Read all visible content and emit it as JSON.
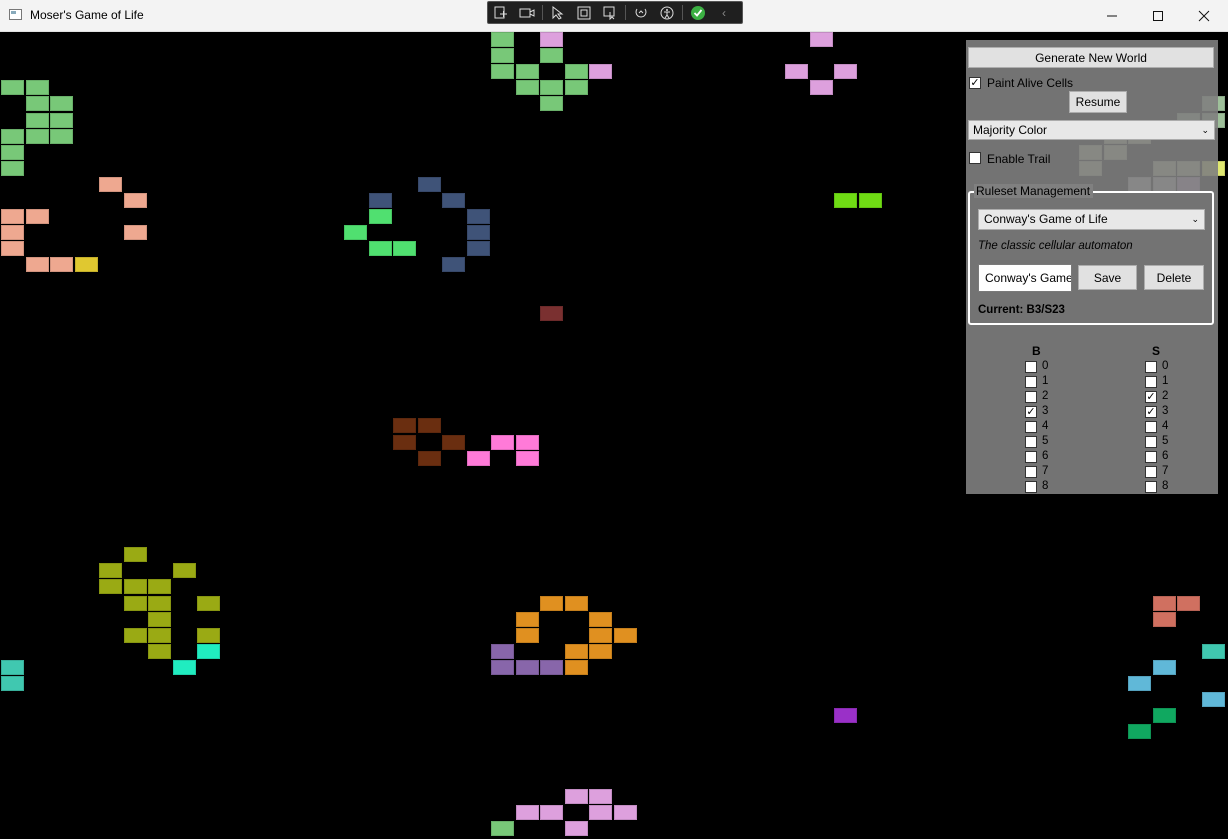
{
  "window": {
    "title": "Moser's Game of Life",
    "controls": [
      "minimize",
      "maximize",
      "close"
    ]
  },
  "debug_toolbar": {
    "icons": [
      "live-visual-tree-icon",
      "record-icon",
      "select-element-icon",
      "display-layout-adorners-icon",
      "track-focus-icon",
      "hot-reload-icon",
      "accessibility-icon",
      "check-icon",
      "collapse-icon"
    ]
  },
  "controls": {
    "generate_label": "Generate New World",
    "paint_alive_label": "Paint Alive Cells",
    "paint_alive_checked": true,
    "resume_label": "Resume",
    "color_mode_selected": "Majority Color",
    "enable_trail_label": "Enable Trail",
    "enable_trail_checked": false
  },
  "ruleset": {
    "legend": "Ruleset Management",
    "selected": "Conway's Game of Life",
    "description": "The classic cellular automaton",
    "name_value": "Conway's Game",
    "save_label": "Save",
    "delete_label": "Delete",
    "current_label": "Current: B3/S23"
  },
  "rules": {
    "birth_header": "B",
    "survival_header": "S",
    "birth": [
      {
        "n": "0",
        "checked": false
      },
      {
        "n": "1",
        "checked": false
      },
      {
        "n": "2",
        "checked": false
      },
      {
        "n": "3",
        "checked": true
      },
      {
        "n": "4",
        "checked": false
      },
      {
        "n": "5",
        "checked": false
      },
      {
        "n": "6",
        "checked": false
      },
      {
        "n": "7",
        "checked": false
      },
      {
        "n": "8",
        "checked": false
      }
    ],
    "survival": [
      {
        "n": "0",
        "checked": false
      },
      {
        "n": "1",
        "checked": false
      },
      {
        "n": "2",
        "checked": true
      },
      {
        "n": "3",
        "checked": true
      },
      {
        "n": "4",
        "checked": false
      },
      {
        "n": "5",
        "checked": false
      },
      {
        "n": "6",
        "checked": false
      },
      {
        "n": "7",
        "checked": false
      },
      {
        "n": "8",
        "checked": false
      }
    ]
  },
  "grid": {
    "background": "#000000",
    "cells": [
      [
        20,
        0,
        "#78c878"
      ],
      [
        22,
        0,
        "#dda0dd"
      ],
      [
        33,
        0,
        "#dda0dd"
      ],
      [
        20,
        1,
        "#78c878"
      ],
      [
        22,
        1,
        "#78c878"
      ],
      [
        20,
        2,
        "#78c878"
      ],
      [
        21,
        2,
        "#78c878"
      ],
      [
        23,
        2,
        "#78c878"
      ],
      [
        24,
        2,
        "#dda0dd"
      ],
      [
        32,
        2,
        "#dda0dd"
      ],
      [
        34,
        2,
        "#dda0dd"
      ],
      [
        0,
        3,
        "#78c878"
      ],
      [
        1,
        3,
        "#78c878"
      ],
      [
        21,
        3,
        "#78c878"
      ],
      [
        22,
        3,
        "#78c878"
      ],
      [
        23,
        3,
        "#78c878"
      ],
      [
        33,
        3,
        "#dda0dd"
      ],
      [
        1,
        4,
        "#78c878"
      ],
      [
        2,
        4,
        "#78c878"
      ],
      [
        22,
        4,
        "#78c878"
      ],
      [
        1,
        5,
        "#78c878"
      ],
      [
        2,
        5,
        "#78c878"
      ],
      [
        0,
        6,
        "#78c878"
      ],
      [
        1,
        6,
        "#78c878"
      ],
      [
        2,
        6,
        "#78c878"
      ],
      [
        0,
        7,
        "#78c878"
      ],
      [
        0,
        8,
        "#78c878"
      ],
      [
        4,
        9,
        "#eea890"
      ],
      [
        17,
        9,
        "#3f5378"
      ],
      [
        5,
        10,
        "#eea890"
      ],
      [
        15,
        10,
        "#3f5378"
      ],
      [
        18,
        10,
        "#3f5378"
      ],
      [
        34,
        10,
        "#6fdc14"
      ],
      [
        35,
        10,
        "#6fdc14"
      ],
      [
        0,
        11,
        "#eea890"
      ],
      [
        1,
        11,
        "#eea890"
      ],
      [
        15,
        11,
        "#50e070"
      ],
      [
        19,
        11,
        "#3f5378"
      ],
      [
        0,
        12,
        "#eea890"
      ],
      [
        5,
        12,
        "#eea890"
      ],
      [
        14,
        12,
        "#50e070"
      ],
      [
        19,
        12,
        "#3f5378"
      ],
      [
        0,
        13,
        "#eea890"
      ],
      [
        15,
        13,
        "#50e070"
      ],
      [
        16,
        13,
        "#50e070"
      ],
      [
        19,
        13,
        "#3f5378"
      ],
      [
        1,
        14,
        "#eea890"
      ],
      [
        2,
        14,
        "#eea890"
      ],
      [
        3,
        14,
        "#e0c830"
      ],
      [
        18,
        14,
        "#3f5378"
      ],
      [
        22,
        17,
        "#7a3030"
      ],
      [
        16,
        24,
        "#6a2e10"
      ],
      [
        17,
        24,
        "#6a2e10"
      ],
      [
        16,
        25,
        "#6a2e10"
      ],
      [
        18,
        25,
        "#6a2e10"
      ],
      [
        20,
        25,
        "#ff7ad8"
      ],
      [
        21,
        25,
        "#ff7ad8"
      ],
      [
        17,
        26,
        "#6a2e10"
      ],
      [
        19,
        26,
        "#ff7ad8"
      ],
      [
        21,
        26,
        "#ff7ad8"
      ],
      [
        5,
        32,
        "#9aaa14"
      ],
      [
        4,
        33,
        "#9aaa14"
      ],
      [
        7,
        33,
        "#9aaa14"
      ],
      [
        4,
        34,
        "#9aaa14"
      ],
      [
        5,
        34,
        "#9aaa14"
      ],
      [
        6,
        34,
        "#9aaa14"
      ],
      [
        5,
        35,
        "#9aaa14"
      ],
      [
        6,
        35,
        "#9aaa14"
      ],
      [
        8,
        35,
        "#9aaa14"
      ],
      [
        22,
        35,
        "#e09020"
      ],
      [
        23,
        35,
        "#e09020"
      ],
      [
        47,
        35,
        "#d07060"
      ],
      [
        48,
        35,
        "#d07060"
      ],
      [
        6,
        36,
        "#9aaa14"
      ],
      [
        21,
        36,
        "#e09020"
      ],
      [
        24,
        36,
        "#e09020"
      ],
      [
        47,
        36,
        "#d07060"
      ],
      [
        5,
        37,
        "#9aaa14"
      ],
      [
        6,
        37,
        "#9aaa14"
      ],
      [
        8,
        37,
        "#9aaa14"
      ],
      [
        21,
        37,
        "#e09020"
      ],
      [
        24,
        37,
        "#e09020"
      ],
      [
        25,
        37,
        "#e09020"
      ],
      [
        6,
        38,
        "#9aaa14"
      ],
      [
        8,
        38,
        "#20ecc0"
      ],
      [
        20,
        38,
        "#8866aa"
      ],
      [
        23,
        38,
        "#e09020"
      ],
      [
        24,
        38,
        "#e09020"
      ],
      [
        49,
        38,
        "#40c8b0"
      ],
      [
        0,
        39,
        "#40c8b0"
      ],
      [
        7,
        39,
        "#20ecc0"
      ],
      [
        20,
        39,
        "#8866aa"
      ],
      [
        21,
        39,
        "#8866aa"
      ],
      [
        22,
        39,
        "#8866aa"
      ],
      [
        23,
        39,
        "#e09020"
      ],
      [
        47,
        39,
        "#60b8d8"
      ],
      [
        0,
        40,
        "#40c8b0"
      ],
      [
        46,
        40,
        "#60b8d8"
      ],
      [
        49,
        41,
        "#60b8d8"
      ],
      [
        34,
        42,
        "#9a30c8"
      ],
      [
        47,
        42,
        "#10a860"
      ],
      [
        46,
        43,
        "#10a860"
      ],
      [
        23,
        47,
        "#dda0dd"
      ],
      [
        24,
        47,
        "#dda0dd"
      ],
      [
        21,
        48,
        "#dda0dd"
      ],
      [
        22,
        48,
        "#dda0dd"
      ],
      [
        24,
        48,
        "#dda0dd"
      ],
      [
        25,
        48,
        "#dda0dd"
      ],
      [
        20,
        49,
        "#78c878"
      ],
      [
        23,
        49,
        "#dda0dd"
      ],
      [
        49,
        4,
        "#9ec09a"
      ],
      [
        48,
        5,
        "#9ec09a"
      ],
      [
        49,
        5,
        "#9ec09a"
      ],
      [
        45,
        6,
        "#c8d4a0"
      ],
      [
        46,
        6,
        "#c8d4a0"
      ],
      [
        44,
        7,
        "#c8d4a0"
      ],
      [
        45,
        7,
        "#c8d4a0"
      ],
      [
        44,
        8,
        "#c8d4a0"
      ],
      [
        47,
        8,
        "#c8d4a0"
      ],
      [
        48,
        8,
        "#c8d4a0"
      ],
      [
        49,
        8,
        "#e0e870"
      ],
      [
        46,
        9,
        "#c8c8c8"
      ],
      [
        47,
        9,
        "#c8c8c8"
      ],
      [
        48,
        9,
        "#c8a0d8"
      ]
    ]
  }
}
